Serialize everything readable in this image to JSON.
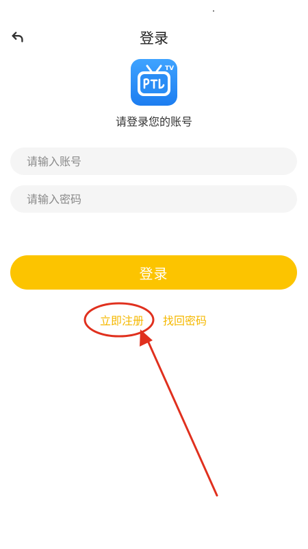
{
  "header": {
    "title": "登录",
    "back_icon": "back-arrow-icon"
  },
  "logo": {
    "icon": "tv-app-logo-icon",
    "brand_color": "#2088f5"
  },
  "subtitle": "请登录您的账号",
  "form": {
    "account_placeholder": "请输入账号",
    "account_value": "",
    "password_placeholder": "请输入密码",
    "password_value": ""
  },
  "login_button": {
    "label": "登录",
    "color": "#fcc400"
  },
  "links": {
    "register": "立即注册",
    "forgot_password": "找回密码",
    "color": "#f5b800"
  },
  "annotation": {
    "type": "red-circle-and-arrow",
    "target": "register-link",
    "color": "#e0301e"
  }
}
